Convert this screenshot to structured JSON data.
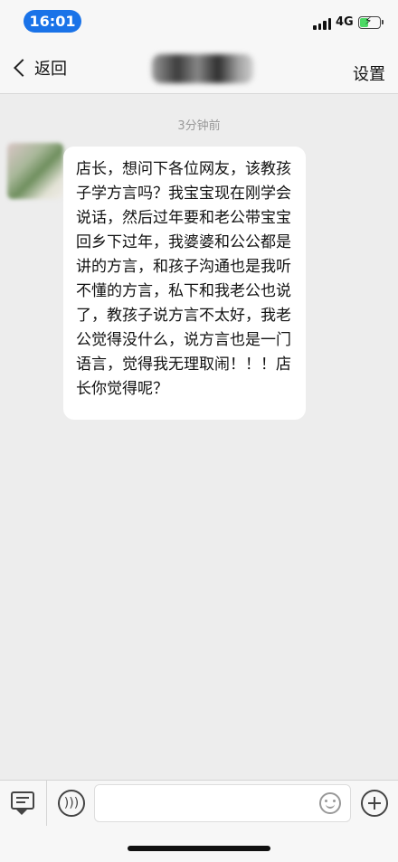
{
  "status_bar": {
    "time": "16:01",
    "network": "4G",
    "signal_bars": 4,
    "battery_level": 0.45
  },
  "nav": {
    "back_label": "返回",
    "settings_label": "设置"
  },
  "chat": {
    "timestamp": "3分钟前",
    "messages": [
      {
        "sender": "other",
        "text": "店长，想问下各位网友，该教孩子学方言吗？我宝宝现在刚学会说话，然后过年要和老公带宝宝回乡下过年，我婆婆和公公都是讲的方言，和孩子沟通也是我听不懂的方言，私下和我老公也说了，教孩子说方言不太好，我老公觉得没什么，说方言也是一门语言，觉得我无理取闹！！！店长你觉得呢？"
      }
    ]
  },
  "input_bar": {
    "placeholder": ""
  },
  "icons": {
    "back": "chevron-left-icon",
    "menu": "menu-icon",
    "voice": "voice-icon",
    "emoji": "emoji-icon",
    "plus": "plus-icon"
  },
  "colors": {
    "time_pill": "#1a73e8",
    "battery": "#4cd964",
    "chat_background": "#ededed",
    "bubble": "#ffffff"
  }
}
